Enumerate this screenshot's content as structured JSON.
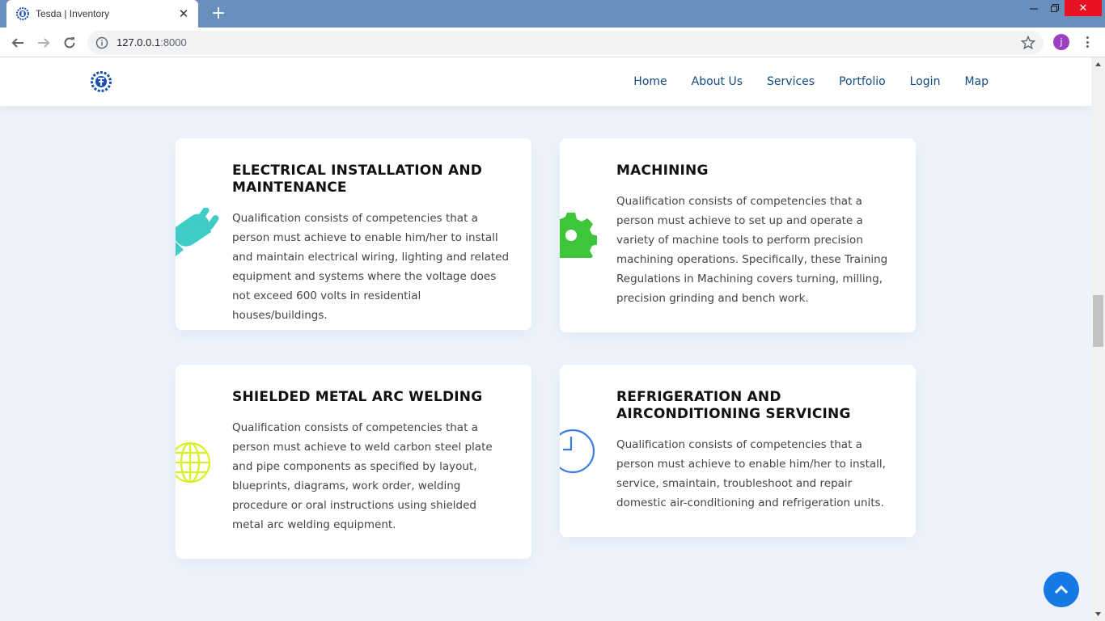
{
  "browser": {
    "tab_title": "Tesda | Inventory",
    "tab_favicon": "tesda-logo-icon",
    "url_host": "127.0.0.1",
    "url_port": ":8000",
    "profile_initial": "j",
    "profile_color": "#9c3fc2"
  },
  "site": {
    "logo": "tesda-logo-icon",
    "brand_color": "#1a4fb0",
    "nav": [
      {
        "label": "Home"
      },
      {
        "label": "About Us"
      },
      {
        "label": "Services"
      },
      {
        "label": "Portfolio"
      },
      {
        "label": "Login"
      },
      {
        "label": "Map"
      }
    ]
  },
  "services": [
    {
      "title": "ELECTRICAL INSTALLATION AND MAINTENANCE",
      "description": "Qualification consists of competencies that a person must achieve to enable him/her to install and maintain electrical wiring, lighting and related equipment and systems where the voltage does not exceed 600 volts in residential houses/buildings.",
      "icon": "plug-icon",
      "icon_color": "#3fcbc6"
    },
    {
      "title": "MACHINING",
      "description": "Qualification consists of competencies that a person must achieve to set up and operate a variety of machine tools to perform precision machining operations. Specifically, these Training Regulations in Machining covers turning, milling, precision grinding and bench work.",
      "icon": "gear-icon",
      "icon_color": "#3ec63a"
    },
    {
      "title": "SHIELDED METAL ARC WELDING",
      "description": "Qualification consists of competencies that a person must achieve to weld carbon steel plate and pipe components as specified by layout, blueprints, diagrams, work order, welding procedure or oral instructions using shielded metal arc welding equipment.",
      "icon": "globe-icon",
      "icon_color": "#d8ef24"
    },
    {
      "title": "REFRIGERATION AND AIRCONDITIONING SERVICING",
      "description": "Qualification consists of competencies that a person must achieve to enable him/her to install, service, smaintain, troubleshoot and repair domestic air-conditioning and refrigeration units.",
      "icon": "clock-icon",
      "icon_color": "#3a7bea"
    }
  ],
  "back_to_top_icon": "chevron-up-icon"
}
